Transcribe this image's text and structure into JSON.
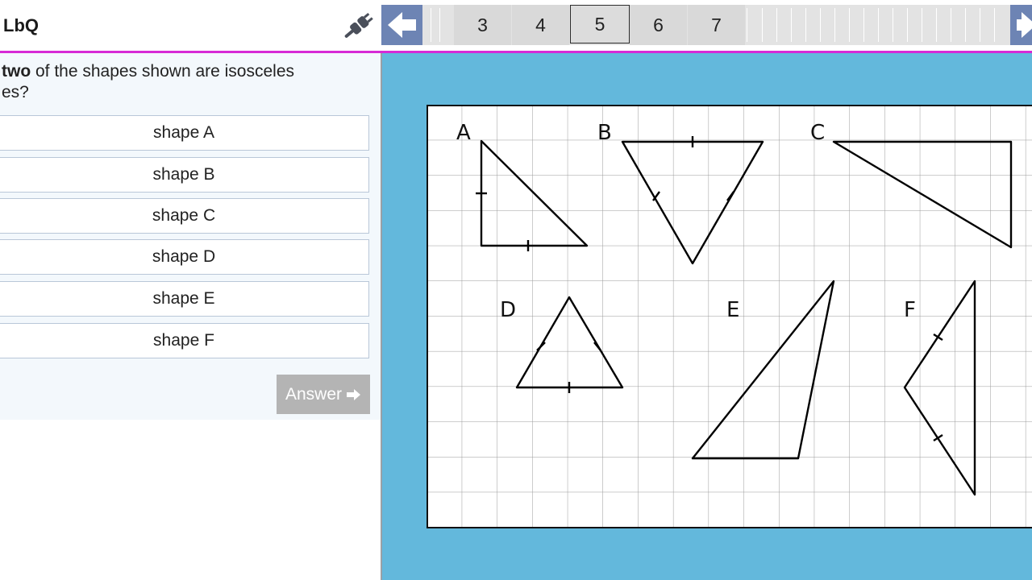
{
  "header": {
    "title": "LbQ",
    "pages": [
      "3",
      "4",
      "5",
      "6",
      "7"
    ],
    "current_page": "5"
  },
  "question": {
    "bold_word": "two",
    "text_line1": " of the shapes shown are isosceles",
    "text_line2": "es?",
    "options": [
      "shape A",
      "shape B",
      "shape C",
      "shape D",
      "shape E",
      "shape F"
    ],
    "answer_label": "Answer"
  },
  "figure": {
    "labels": [
      "A",
      "B",
      "C",
      "D",
      "E",
      "F"
    ]
  },
  "colors": {
    "accent_line": "#d62ad6",
    "nav_arrow": "#6d84b4",
    "figure_background": "#63b8dc",
    "answer_button": "#b4b4b4"
  }
}
